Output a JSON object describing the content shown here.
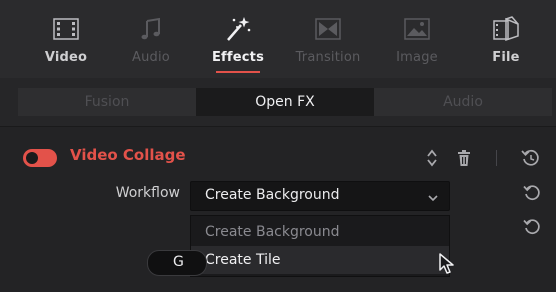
{
  "tabs": [
    {
      "label": "Video",
      "icon": "film-icon",
      "state": "normal"
    },
    {
      "label": "Audio",
      "icon": "music-note-icon",
      "state": "dim"
    },
    {
      "label": "Effects",
      "icon": "magic-wand-icon",
      "state": "active"
    },
    {
      "label": "Transition",
      "icon": "transition-icon",
      "state": "dim"
    },
    {
      "label": "Image",
      "icon": "image-icon",
      "state": "dim"
    },
    {
      "label": "File",
      "icon": "file-icon",
      "state": "normal"
    }
  ],
  "segments": [
    {
      "label": "Fusion",
      "state": "dim"
    },
    {
      "label": "Open FX",
      "state": "active"
    },
    {
      "label": "Audio",
      "state": "dim"
    }
  ],
  "effect": {
    "title": "Video Collage",
    "enabled": true,
    "workflow_label": "Workflow",
    "workflow_value": "Create Background"
  },
  "dropdown": {
    "options": [
      "Create Background",
      "Create Tile"
    ],
    "hovered": "Create Tile"
  },
  "obscured_button_text": "G",
  "colors": {
    "accent": "#e3524a",
    "panel_bg": "#232325",
    "topbar_bg": "#2b2b2d"
  }
}
